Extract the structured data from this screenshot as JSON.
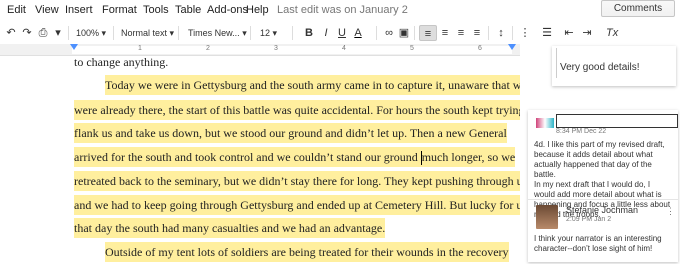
{
  "menu": {
    "items": [
      "Edit",
      "View",
      "Insert",
      "Format",
      "Tools",
      "Table",
      "Add-ons",
      "Help"
    ],
    "last_edit": "Last edit was on January 2",
    "comments_button": "Comments"
  },
  "toolbar": {
    "zoom": "100%",
    "style": "Normal text",
    "font": "Times New...",
    "size": "12",
    "bold": "B",
    "italic": "I",
    "underline": "U",
    "text_color": "A",
    "clear_format": "Tx"
  },
  "ruler": {
    "numbers": [
      "1",
      "2",
      "3",
      "4",
      "5",
      "6",
      "7"
    ]
  },
  "document": {
    "lines": [
      {
        "text": "to change anything.",
        "indent": false,
        "highlight": false
      },
      {
        "text": "Today we were in Gettysburg and the south army came in to capture it, unaware that we",
        "indent": true,
        "highlight": true
      },
      {
        "text": "were already there, the start of this battle was quite accidental. For hours the south kept trying to",
        "indent": false,
        "highlight": true
      },
      {
        "text": "flank us and take us down, but we stood our ground and didn’t let up. Then a new General",
        "indent": false,
        "highlight": true
      },
      {
        "text_before_cursor": "arrived for the south and took control and we couldn’t stand our ground ",
        "text_after_cursor": "much longer, so we",
        "indent": false,
        "highlight": true
      },
      {
        "text": "retreated back to the seminary, but we didn’t stay there for long. They kept pushing through us",
        "indent": false,
        "highlight": true
      },
      {
        "text": "and we had to keep going through Gettysburg and ended up at Cemetery Hill. But lucky for us,",
        "indent": false,
        "highlight": true
      },
      {
        "text": "that day the south had many casualties and we had an advantage.",
        "indent": false,
        "highlight": true
      },
      {
        "text": "Outside of my tent lots of soldiers are being treated for  their wounds in the recovery",
        "indent": true,
        "highlight": true
      }
    ]
  },
  "comments": {
    "first": {
      "text": "Very good details!"
    },
    "second": {
      "date": "8:34 PM Dec 22",
      "body": "4d. I like this part of my revised draft, because it adds detail about what actually happened that day of the battle.\nIn my next draft that I would do, I would add more detail about what is happening and focus a little less about me and the troops."
    },
    "reply": {
      "author": "Stefanie Jochman",
      "date": "2:09 PM Jan 2",
      "body": "I think your narrator is an interesting character--don’t lose sight of him!"
    }
  },
  "colors": {
    "highlight": "#ffef9e",
    "accent": "#4d90fe"
  }
}
